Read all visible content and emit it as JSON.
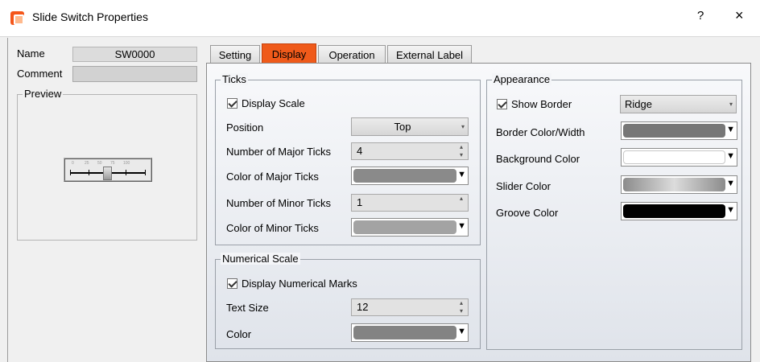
{
  "window": {
    "title": "Slide Switch Properties",
    "help": "?",
    "close": "×"
  },
  "left": {
    "name_label": "Name",
    "name_value": "SW0000",
    "comment_label": "Comment",
    "preview_label": "Preview",
    "preview_ticks": [
      "0",
      "25",
      "50",
      "75",
      "100"
    ]
  },
  "tabs": [
    {
      "label": "Setting"
    },
    {
      "label": "Display"
    },
    {
      "label": "Operation"
    },
    {
      "label": "External Label"
    }
  ],
  "ticks": {
    "title": "Ticks",
    "display_scale": "Display Scale",
    "position_label": "Position",
    "position_value": "Top",
    "major_label": "Number of Major Ticks",
    "major_value": "4",
    "major_color_label": "Color of Major Ticks",
    "minor_label": "Number of Minor Ticks",
    "minor_value": "1",
    "minor_color_label": "Color of Minor Ticks"
  },
  "numerical": {
    "title": "Numerical Scale",
    "display_marks": "Display Numerical Marks",
    "text_size_label": "Text Size",
    "text_size_value": "12",
    "color_label": "Color"
  },
  "appearance": {
    "title": "Appearance",
    "show_border": "Show Border",
    "border_style": "Ridge",
    "border_color_label": "Border Color/Width",
    "background_label": "Background Color",
    "slider_label": "Slider Color",
    "groove_label": "Groove Color"
  },
  "colors": {
    "accent": "#ef5a1a",
    "major_ticks": "#8a8a8a",
    "minor_ticks": "#a3a3a3",
    "numerical": "#838383",
    "border": "#777777",
    "background": "#ffffff",
    "slider_start": "#8c8c8c",
    "slider_end": "#dcdcdc",
    "groove": "#000000"
  },
  "icons": {
    "app": "slide-switch-app-icon",
    "checkbox": "checkmark-icon",
    "dropdown": "chevron-down-icon",
    "spinner": "up-down-spinner-icon"
  }
}
